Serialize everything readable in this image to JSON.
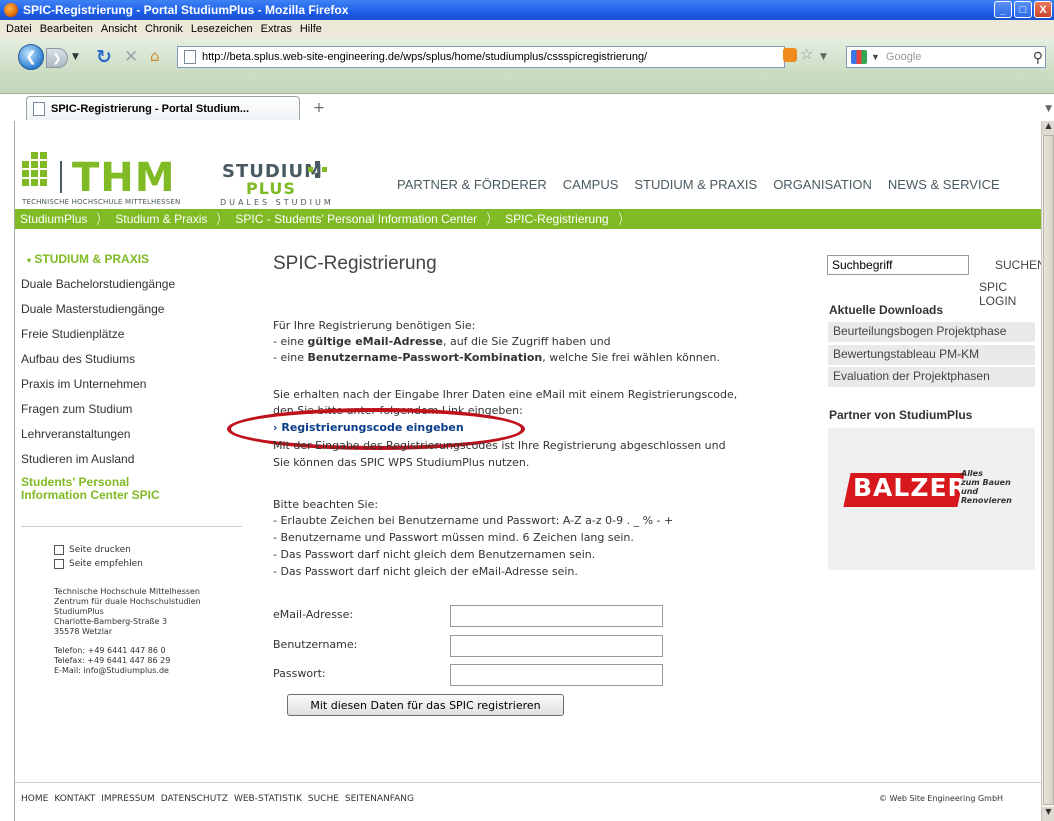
{
  "window": {
    "title": "SPIC-Registrierung - Portal StudiumPlus - Mozilla Firefox",
    "buttons": [
      "_",
      "□",
      "X"
    ]
  },
  "menu": [
    "Datei",
    "Bearbeiten",
    "Ansicht",
    "Chronik",
    "Lesezeichen",
    "Extras",
    "Hilfe"
  ],
  "toolbar": {
    "url": "http://beta.splus.web-site-engineering.de/wps/splus/home/studiumplus/cssspicregistrierung/",
    "search_placeholder": "Google",
    "icons": [
      "back-icon",
      "forward-icon",
      "reload-icon",
      "stop-icon",
      "home-icon",
      "rss-icon",
      "star-icon",
      "search-engine-icon",
      "magnifier-icon"
    ]
  },
  "tab": {
    "label": "SPIC-Registrierung - Portal Studium...",
    "new_tab": "+"
  },
  "header": {
    "thm": "THM",
    "thm_subtitle": "TECHNISCHE HOCHSCHULE MITTELHESSEN",
    "studium": "STUDIUM",
    "plus": "PLUS",
    "studium_subtitle": "DUALES STUDIUM",
    "nav": [
      "PARTNER & FÖRDERER",
      "CAMPUS",
      "STUDIUM & PRAXIS",
      "ORGANISATION",
      "NEWS & SERVICE"
    ],
    "brand_green": "#80ba24"
  },
  "breadcrumb": [
    "StudiumPlus",
    "Studium & Praxis",
    "SPIC - Students' Personal Information Center",
    "SPIC-Registrierung"
  ],
  "sidebar": {
    "title": "STUDIUM & PRAXIS",
    "items": [
      "Duale Bachelorstudiengänge",
      "Duale Masterstudiengänge",
      "Freie Studienplätze",
      "Aufbau des Studiums",
      "Praxis im Unternehmen",
      "Fragen zum Studium",
      "Lehrveranstaltungen",
      "Studieren im Ausland"
    ],
    "active_line1": "Students' Personal",
    "active_line2": "Information Center SPIC",
    "print": "Seite drucken",
    "recommend": "Seite empfehlen",
    "address": [
      "Technische Hochschule Mittelhessen",
      "Zentrum für duale Hochschulstudien",
      "StudiumPlus",
      "Charlotte-Bamberg-Straße 3",
      "35578 Wetzlar"
    ],
    "contact": [
      "Telefon: +49 6441 447 86 0",
      "Telefax: +49 6441 447 86 29",
      "E-Mail: info@Studiumplus.de"
    ]
  },
  "main": {
    "title": "SPIC-Registrierung",
    "intro": "Für Ihre Registrierung benötigen Sie:",
    "req1_pre": "-  eine ",
    "req1_bold": "gültige eMail-Adresse",
    "req1_post": ", auf die Sie Zugriff haben und",
    "req2_pre": "-  eine ",
    "req2_bold": "Benutzername-Passwort-Kombination",
    "req2_post": ", welche Sie frei wählen können.",
    "info1": "Sie erhalten nach der Eingabe Ihrer Daten eine eMail mit einem Registrierungscode,",
    "info2": "den Sie bitte unter folgendem Link eingeben:",
    "link": "› Registrierungscode eingeben",
    "info3": "Mit der Eingabe des Registrierungscodes ist Ihre Registrierung abgeschlossen und",
    "info4": "Sie können das SPIC WPS StudiumPlus nutzen.",
    "note_title": "Bitte beachten Sie:",
    "notes": [
      "-  Erlaubte Zeichen bei Benutzername und Passwort: A-Z a-z 0-9 . _ % - +",
      "-  Benutzername und Passwort müssen mind. 6 Zeichen lang sein.",
      "-  Das Passwort darf nicht gleich dem Benutzernamen sein.",
      "-  Das Passwort darf nicht gleich der eMail-Adresse sein."
    ],
    "email_label": "eMail-Adresse:",
    "user_label": "Benutzername:",
    "pass_label": "Passwort:",
    "submit": "Mit diesen Daten für das SPIC registrieren",
    "highlight_color": "#c0121b"
  },
  "right": {
    "search_value": "Suchbegriff",
    "search_button": "SUCHEN",
    "login": "SPIC LOGIN",
    "downloads_title": "Aktuelle Downloads",
    "downloads": [
      "Beurteilungsbogen Projektphase",
      "Bewertungstableau PM-KM",
      "Evaluation der Projektphasen"
    ],
    "partner_title": "Partner von StudiumPlus",
    "partner_logo": "BALZER",
    "partner_slogan1": "Alles",
    "partner_slogan2": "zum Bauen",
    "partner_slogan3": "und Renovieren"
  },
  "footer": {
    "links": [
      "HOME",
      "KONTAKT",
      "IMPRESSUM",
      "DATENSCHUTZ",
      "WEB-STATISTIK",
      "SUCHE",
      "SEITENANFANG"
    ],
    "copyright": "© Web Site Engineering GmbH"
  }
}
